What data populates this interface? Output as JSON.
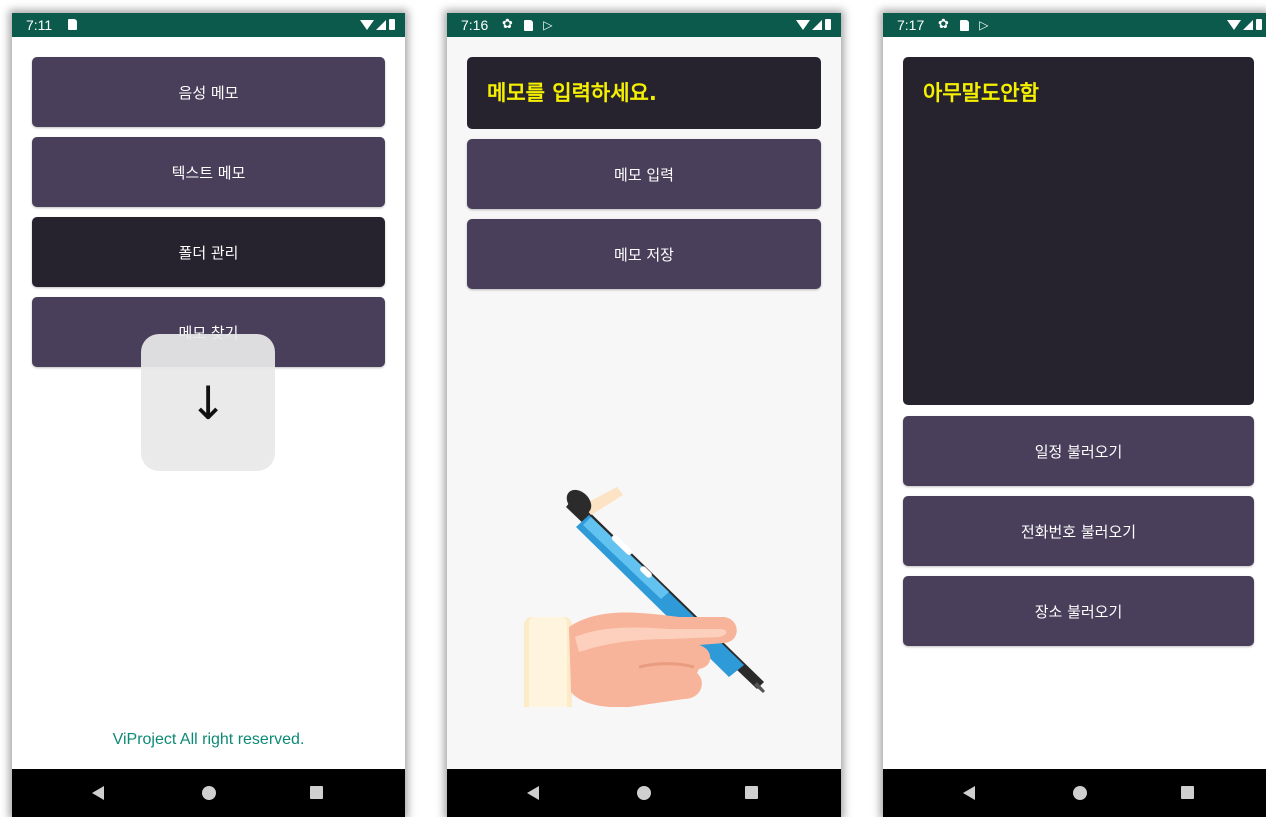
{
  "screens": [
    {
      "status_time": "7:11",
      "buttons": [
        "음성 메모",
        "텍스트 메모",
        "폴더 관리",
        "메모 찾기"
      ],
      "overlay_icon": "↓",
      "footer": "ViProject All right reserved."
    },
    {
      "status_time": "7:16",
      "memo_placeholder": "메모를 입력하세요.",
      "buttons": [
        "메모 입력",
        "메모 저장"
      ],
      "illustration": "hand-writing-pen-illustration"
    },
    {
      "status_time": "7:17",
      "memo_text": "아무말도안함",
      "buttons": [
        "일정 불러오기",
        "전화번호 불러오기",
        "장소 불러오기"
      ]
    }
  ],
  "colors": {
    "status_bar": "#0b5a4c",
    "button": "#4a3f5a",
    "button_dark": "#26232f",
    "memo_text": "#f4f000",
    "footer_text": "#0d8a76"
  }
}
